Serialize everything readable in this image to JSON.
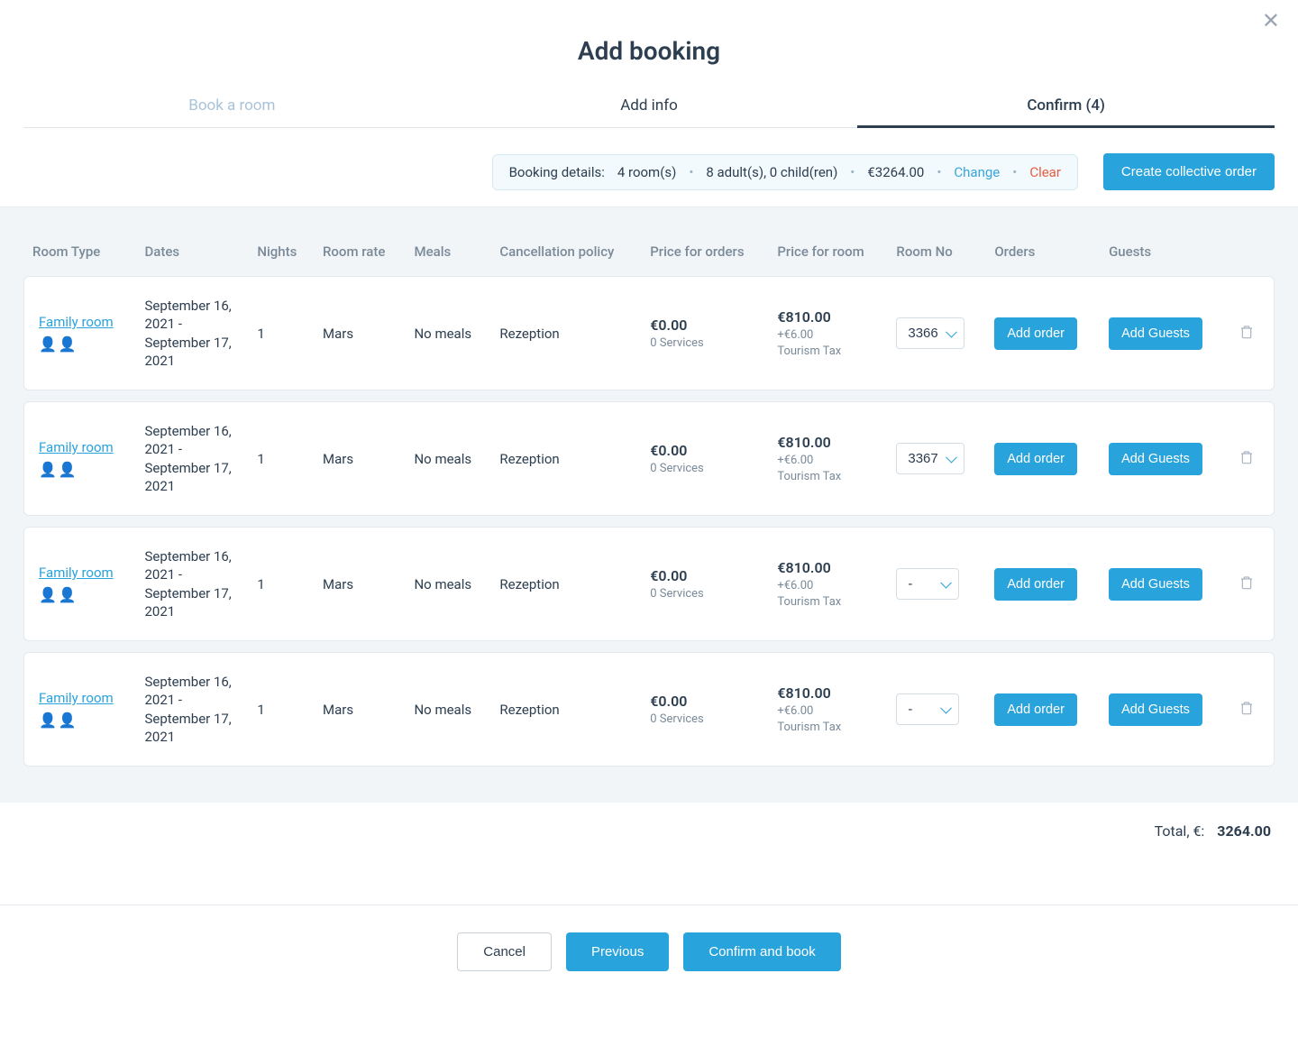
{
  "header": {
    "title": "Add booking"
  },
  "tabs": {
    "book": "Book a room",
    "info": "Add info",
    "confirm": "Confirm (4)"
  },
  "summary": {
    "label": "Booking details:",
    "rooms": "4 room(s)",
    "guests": "8 adult(s), 0 child(ren)",
    "total": "€3264.00",
    "change": "Change",
    "clear": "Clear"
  },
  "buttons": {
    "create_collective": "Create collective order",
    "add_order": "Add order",
    "add_guests": "Add Guests",
    "cancel": "Cancel",
    "previous": "Previous",
    "confirm_book": "Confirm and book"
  },
  "columns": {
    "room_type": "Room Type",
    "dates": "Dates",
    "nights": "Nights",
    "rate": "Room rate",
    "meals": "Meals",
    "cancel": "Cancellation policy",
    "price_orders": "Price for orders",
    "price_room": "Price for room",
    "room_no": "Room No",
    "orders": "Orders",
    "guests": "Guests"
  },
  "rows": [
    {
      "room_type": "Family room",
      "dates": "September 16, 2021 - September 17, 2021",
      "nights": "1",
      "rate": "Mars",
      "meals": "No meals",
      "cancel": "Rezeption",
      "order_price": "€0.00",
      "order_sub": "0 Services",
      "room_price": "€810.00",
      "room_sub1": "+€6.00",
      "room_sub2": "Tourism Tax",
      "room_no": "3366"
    },
    {
      "room_type": "Family room",
      "dates": "September 16, 2021 - September 17, 2021",
      "nights": "1",
      "rate": "Mars",
      "meals": "No meals",
      "cancel": "Rezeption",
      "order_price": "€0.00",
      "order_sub": "0 Services",
      "room_price": "€810.00",
      "room_sub1": "+€6.00",
      "room_sub2": "Tourism Tax",
      "room_no": "3367"
    },
    {
      "room_type": "Family room",
      "dates": "September 16, 2021 - September 17, 2021",
      "nights": "1",
      "rate": "Mars",
      "meals": "No meals",
      "cancel": "Rezeption",
      "order_price": "€0.00",
      "order_sub": "0 Services",
      "room_price": "€810.00",
      "room_sub1": "+€6.00",
      "room_sub2": "Tourism Tax",
      "room_no": "-"
    },
    {
      "room_type": "Family room",
      "dates": "September 16, 2021 - September 17, 2021",
      "nights": "1",
      "rate": "Mars",
      "meals": "No meals",
      "cancel": "Rezeption",
      "order_price": "€0.00",
      "order_sub": "0 Services",
      "room_price": "€810.00",
      "room_sub1": "+€6.00",
      "room_sub2": "Tourism Tax",
      "room_no": "-"
    }
  ],
  "total": {
    "label": "Total, €:",
    "value": "3264.00"
  }
}
